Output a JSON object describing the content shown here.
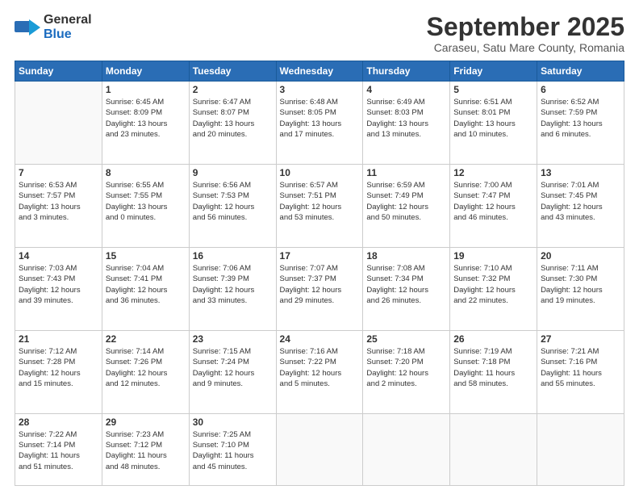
{
  "logo": {
    "general": "General",
    "blue": "Blue"
  },
  "title": "September 2025",
  "subtitle": "Caraseu, Satu Mare County, Romania",
  "days_of_week": [
    "Sunday",
    "Monday",
    "Tuesday",
    "Wednesday",
    "Thursday",
    "Friday",
    "Saturday"
  ],
  "weeks": [
    [
      {
        "day": "",
        "info": ""
      },
      {
        "day": "1",
        "info": "Sunrise: 6:45 AM\nSunset: 8:09 PM\nDaylight: 13 hours\nand 23 minutes."
      },
      {
        "day": "2",
        "info": "Sunrise: 6:47 AM\nSunset: 8:07 PM\nDaylight: 13 hours\nand 20 minutes."
      },
      {
        "day": "3",
        "info": "Sunrise: 6:48 AM\nSunset: 8:05 PM\nDaylight: 13 hours\nand 17 minutes."
      },
      {
        "day": "4",
        "info": "Sunrise: 6:49 AM\nSunset: 8:03 PM\nDaylight: 13 hours\nand 13 minutes."
      },
      {
        "day": "5",
        "info": "Sunrise: 6:51 AM\nSunset: 8:01 PM\nDaylight: 13 hours\nand 10 minutes."
      },
      {
        "day": "6",
        "info": "Sunrise: 6:52 AM\nSunset: 7:59 PM\nDaylight: 13 hours\nand 6 minutes."
      }
    ],
    [
      {
        "day": "7",
        "info": "Sunrise: 6:53 AM\nSunset: 7:57 PM\nDaylight: 13 hours\nand 3 minutes."
      },
      {
        "day": "8",
        "info": "Sunrise: 6:55 AM\nSunset: 7:55 PM\nDaylight: 13 hours\nand 0 minutes."
      },
      {
        "day": "9",
        "info": "Sunrise: 6:56 AM\nSunset: 7:53 PM\nDaylight: 12 hours\nand 56 minutes."
      },
      {
        "day": "10",
        "info": "Sunrise: 6:57 AM\nSunset: 7:51 PM\nDaylight: 12 hours\nand 53 minutes."
      },
      {
        "day": "11",
        "info": "Sunrise: 6:59 AM\nSunset: 7:49 PM\nDaylight: 12 hours\nand 50 minutes."
      },
      {
        "day": "12",
        "info": "Sunrise: 7:00 AM\nSunset: 7:47 PM\nDaylight: 12 hours\nand 46 minutes."
      },
      {
        "day": "13",
        "info": "Sunrise: 7:01 AM\nSunset: 7:45 PM\nDaylight: 12 hours\nand 43 minutes."
      }
    ],
    [
      {
        "day": "14",
        "info": "Sunrise: 7:03 AM\nSunset: 7:43 PM\nDaylight: 12 hours\nand 39 minutes."
      },
      {
        "day": "15",
        "info": "Sunrise: 7:04 AM\nSunset: 7:41 PM\nDaylight: 12 hours\nand 36 minutes."
      },
      {
        "day": "16",
        "info": "Sunrise: 7:06 AM\nSunset: 7:39 PM\nDaylight: 12 hours\nand 33 minutes."
      },
      {
        "day": "17",
        "info": "Sunrise: 7:07 AM\nSunset: 7:37 PM\nDaylight: 12 hours\nand 29 minutes."
      },
      {
        "day": "18",
        "info": "Sunrise: 7:08 AM\nSunset: 7:34 PM\nDaylight: 12 hours\nand 26 minutes."
      },
      {
        "day": "19",
        "info": "Sunrise: 7:10 AM\nSunset: 7:32 PM\nDaylight: 12 hours\nand 22 minutes."
      },
      {
        "day": "20",
        "info": "Sunrise: 7:11 AM\nSunset: 7:30 PM\nDaylight: 12 hours\nand 19 minutes."
      }
    ],
    [
      {
        "day": "21",
        "info": "Sunrise: 7:12 AM\nSunset: 7:28 PM\nDaylight: 12 hours\nand 15 minutes."
      },
      {
        "day": "22",
        "info": "Sunrise: 7:14 AM\nSunset: 7:26 PM\nDaylight: 12 hours\nand 12 minutes."
      },
      {
        "day": "23",
        "info": "Sunrise: 7:15 AM\nSunset: 7:24 PM\nDaylight: 12 hours\nand 9 minutes."
      },
      {
        "day": "24",
        "info": "Sunrise: 7:16 AM\nSunset: 7:22 PM\nDaylight: 12 hours\nand 5 minutes."
      },
      {
        "day": "25",
        "info": "Sunrise: 7:18 AM\nSunset: 7:20 PM\nDaylight: 12 hours\nand 2 minutes."
      },
      {
        "day": "26",
        "info": "Sunrise: 7:19 AM\nSunset: 7:18 PM\nDaylight: 11 hours\nand 58 minutes."
      },
      {
        "day": "27",
        "info": "Sunrise: 7:21 AM\nSunset: 7:16 PM\nDaylight: 11 hours\nand 55 minutes."
      }
    ],
    [
      {
        "day": "28",
        "info": "Sunrise: 7:22 AM\nSunset: 7:14 PM\nDaylight: 11 hours\nand 51 minutes."
      },
      {
        "day": "29",
        "info": "Sunrise: 7:23 AM\nSunset: 7:12 PM\nDaylight: 11 hours\nand 48 minutes."
      },
      {
        "day": "30",
        "info": "Sunrise: 7:25 AM\nSunset: 7:10 PM\nDaylight: 11 hours\nand 45 minutes."
      },
      {
        "day": "",
        "info": ""
      },
      {
        "day": "",
        "info": ""
      },
      {
        "day": "",
        "info": ""
      },
      {
        "day": "",
        "info": ""
      }
    ]
  ]
}
